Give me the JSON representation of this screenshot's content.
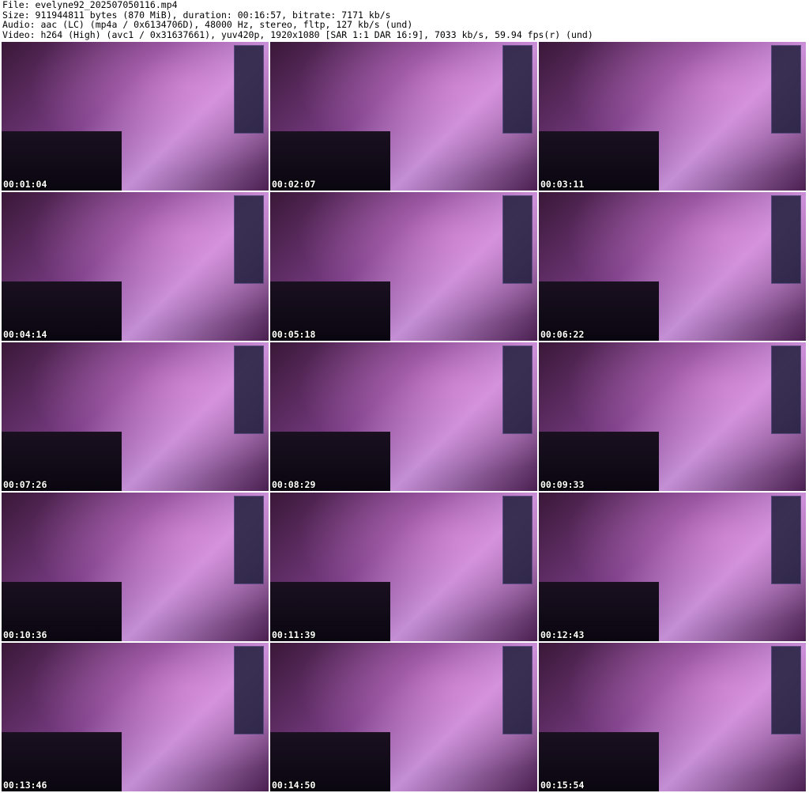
{
  "header": {
    "file": "File: evelyne92_202507050116.mp4",
    "size": "Size: 911944811 bytes (870 MiB), duration: 00:16:57, bitrate: 7171 kb/s",
    "audio": "Audio: aac (LC) (mp4a / 0x6134706D), 48000 Hz, stereo, fltp, 127 kb/s (und)",
    "video": "Video: h264 (High) (avc1 / 0x31637661), yuv420p, 1920x1080 [SAR 1:1 DAR 16:9], 7033 kb/s, 59.94 fps(r) (und)"
  },
  "thumbnails": [
    {
      "timestamp": "00:01:04"
    },
    {
      "timestamp": "00:02:07"
    },
    {
      "timestamp": "00:03:11"
    },
    {
      "timestamp": "00:04:14"
    },
    {
      "timestamp": "00:05:18"
    },
    {
      "timestamp": "00:06:22"
    },
    {
      "timestamp": "00:07:26"
    },
    {
      "timestamp": "00:08:29"
    },
    {
      "timestamp": "00:09:33"
    },
    {
      "timestamp": "00:10:36"
    },
    {
      "timestamp": "00:11:39"
    },
    {
      "timestamp": "00:12:43"
    },
    {
      "timestamp": "00:13:46"
    },
    {
      "timestamp": "00:14:50"
    },
    {
      "timestamp": "00:15:54"
    }
  ]
}
